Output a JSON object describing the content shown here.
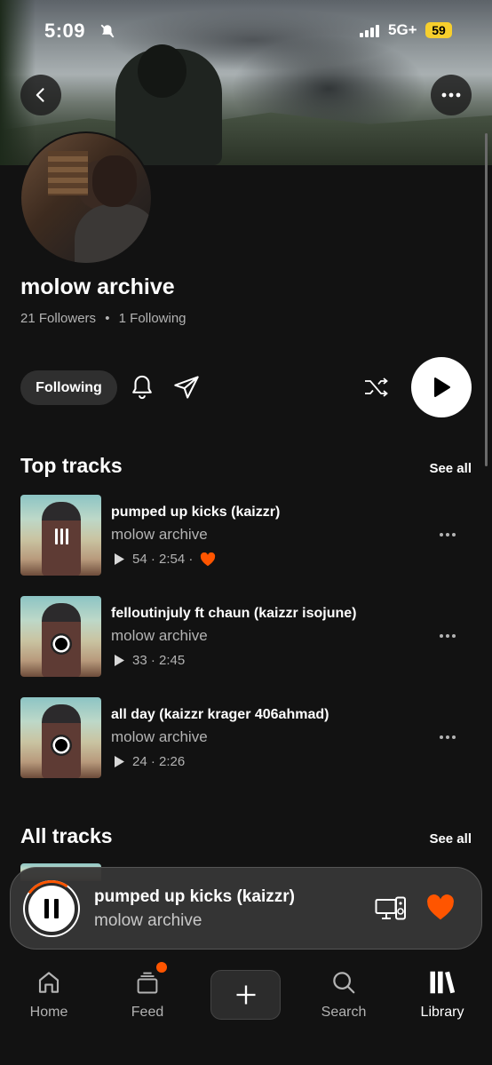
{
  "status_bar": {
    "time": "5:09",
    "network": "5G+",
    "battery": "59"
  },
  "profile": {
    "name": "molow archive",
    "followers": "21 Followers",
    "following": "1 Following",
    "separator": "•",
    "follow_button": "Following"
  },
  "top_tracks": {
    "title": "Top tracks",
    "see_all": "See all",
    "items": [
      {
        "title": "pumped up kicks (kaizzr)",
        "artist": "molow archive",
        "plays": "54",
        "duration": "2:54",
        "liked": true,
        "playing": true
      },
      {
        "title": "felloutinjuly ft chaun (kaizzr isojune)",
        "artist": "molow archive",
        "plays": "33",
        "duration": "2:45",
        "liked": false,
        "playing": false
      },
      {
        "title": "all day (kaizzr krager 406ahmad)",
        "artist": "molow archive",
        "plays": "24",
        "duration": "2:26",
        "liked": false,
        "playing": false
      }
    ]
  },
  "all_tracks": {
    "title": "All tracks",
    "see_all": "See all"
  },
  "mini_player": {
    "title": "pumped up kicks (kaizzr)",
    "artist": "molow archive"
  },
  "nav": {
    "home": "Home",
    "feed": "Feed",
    "search": "Search",
    "library": "Library",
    "active": "library"
  },
  "colors": {
    "accent": "#ff5500",
    "background": "#121212",
    "battery": "#f7cf2d"
  }
}
